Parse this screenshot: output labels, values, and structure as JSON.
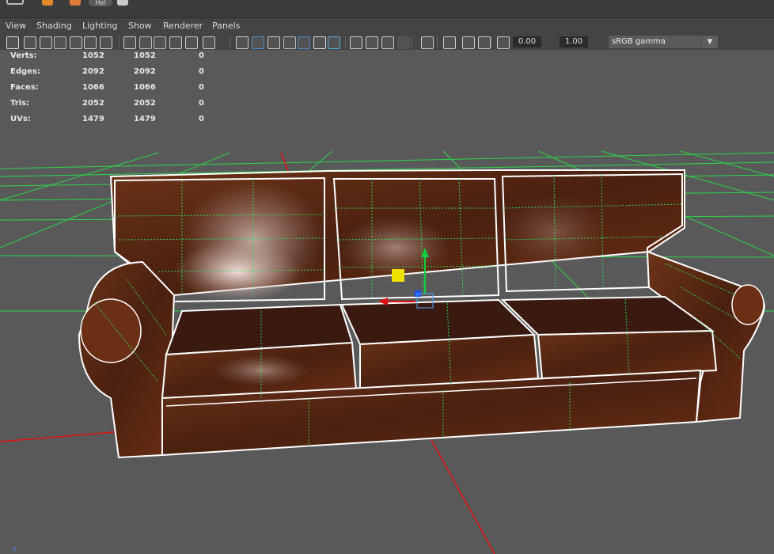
{
  "top_shelf": {
    "tab_label": "Hel"
  },
  "menu": [
    "View",
    "Shading",
    "Lighting",
    "Show",
    "Renderer",
    "Panels"
  ],
  "toolbar": {
    "exposure": "0.00",
    "gamma": "1.00",
    "colorspace": "sRGB gamma",
    "colorspace_arrow": "▼",
    "icons": [
      "camera-select-icon",
      "camera-attributes-icon",
      "bookmark-icon",
      "image-plane-icon",
      "grease-pencil-icon",
      "2d-pan-zoom-icon",
      "film-gate-icon",
      "resolution-gate-icon",
      "gate-mask-icon",
      "field-chart-icon",
      "safe-action-icon",
      "safe-title-icon",
      "wireframe-icon",
      "smooth-shade-icon",
      "wireframe-on-shaded-icon",
      "textured-icon",
      "use-all-lights-icon",
      "shadows-icon",
      "screen-space-ao-icon",
      "motion-blur-icon",
      "multisample-aa-icon",
      "depth-of-field-icon",
      "isolate-select-icon",
      "xray-icon",
      "xray-joints-icon",
      "backface-culling-icon",
      "exposure-icon",
      "gamma-icon",
      "colorspace-toggle-icon"
    ]
  },
  "hud": [
    {
      "label": "Verts:",
      "v1": "1052",
      "v2": "1052",
      "v3": "0"
    },
    {
      "label": "Edges:",
      "v1": "2092",
      "v2": "2092",
      "v3": "0"
    },
    {
      "label": "Faces:",
      "v1": "1066",
      "v2": "1066",
      "v3": "0"
    },
    {
      "label": "Tris:",
      "v1": "2052",
      "v2": "2052",
      "v3": "0"
    },
    {
      "label": "UVs:",
      "v1": "1479",
      "v2": "1479",
      "v3": "0"
    }
  ],
  "colors": {
    "grid": "#27e34a",
    "wire": "#ffffff",
    "leather": "#5a2a14",
    "x_axis": "#e01010",
    "y_axis": "#10d040",
    "z_axis": "#2050ff",
    "pivot": "#f0e000"
  },
  "view_axis_label": "z"
}
